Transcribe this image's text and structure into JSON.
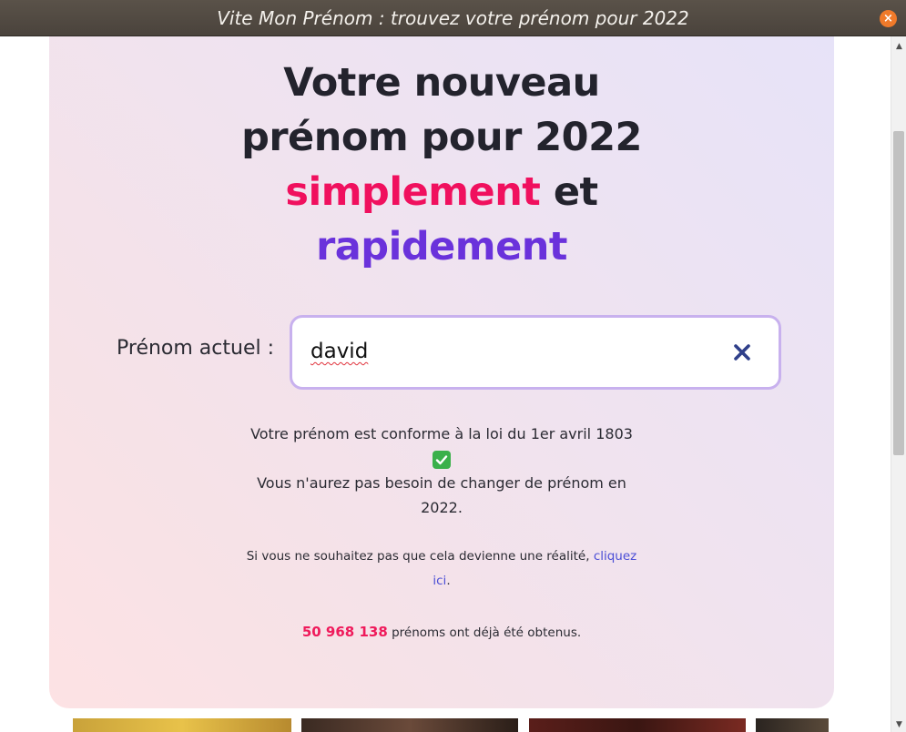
{
  "window": {
    "title": "Vite Mon Prénom : trouvez votre prénom pour 2022",
    "close_icon": "close-icon"
  },
  "headline": {
    "line1": "Votre nouveau",
    "line2": "prénom pour 2022",
    "line3_highlight": "simplement",
    "line3_rest": " et",
    "line4_highlight": "rapidement"
  },
  "form": {
    "label": "Prénom actuel :",
    "value": "david",
    "clear_icon": "close-x-icon"
  },
  "result": {
    "line1": "Votre prénom est conforme à la loi du 1er avril 1803",
    "check_icon": "check-mark-icon",
    "line2": "Vous n'aurez pas besoin de changer de prénom en",
    "line3": "2022."
  },
  "note": {
    "text": "Si vous ne souhaitez pas que cela devienne une réalité, ",
    "link_part1": "cliquez",
    "link_part2": "ici",
    "end": "."
  },
  "counter": {
    "count": "50 968 138",
    "text": " prénoms ont déjà été obtenus."
  },
  "colors": {
    "accent_pink": "#f0105e",
    "accent_purple": "#6a32db",
    "link": "#4b4ed6"
  }
}
